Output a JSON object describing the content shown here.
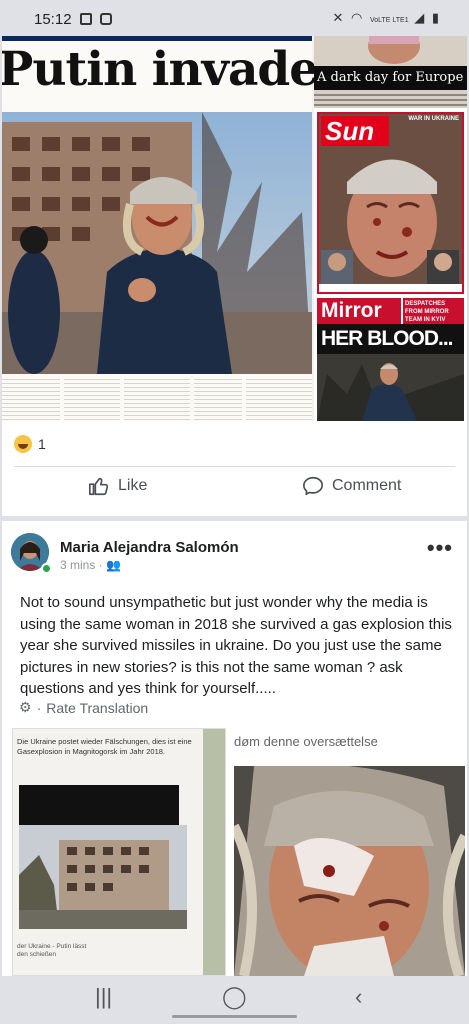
{
  "status_bar": {
    "time": "15:12",
    "network": "VoLTE LTE1",
    "icons": [
      "image-notification-icon",
      "app-notification-icon",
      "mute-icon",
      "wifi-icon",
      "signal-icon",
      "battery-icon"
    ]
  },
  "post": {
    "newspapers": {
      "guardian_headline": "Putin invade",
      "telegraph_banner": "A dark day for Europe",
      "sun_logo": "Sun",
      "sun_tag": "WAR IN UKRAINE",
      "mirror_logo": "Mirror",
      "mirror_tag": "DESPATCHES FROM MIRROR TEAM IN KYIV",
      "mirror_headline": "HER BLOOD..."
    },
    "reaction_count": "1",
    "actions": {
      "like": "Like",
      "comment": "Comment"
    }
  },
  "comment": {
    "author": "Maria Alejandra Salomón",
    "meta": "3 mins · ",
    "text": "Not to sound unsympathetic but just wonder why the media is using the same woman in 2018 she survived a gas explosion this year she survived missiles in ukraine. Do you just use the same pictures in new stories? is this not the same woman ? ask questions and yes think for yourself.....",
    "translate_label": "Rate Translation",
    "left_image_text": "Die Ukraine postet wieder Fälschungen, dies ist eine Gasexplosion in Magnitogorsk im Jahr 2018.",
    "left_image_bottom": "der Ukraine - Putin lässt den schießen",
    "right_image_caption": "døm denne oversættelse"
  },
  "colors": {
    "background": "#dfe1e6",
    "card": "#ffffff",
    "sun_red": "#c8102e",
    "facebook_text": "#1c1e21",
    "meta_grey": "#90949c",
    "online_green": "#31a24c"
  }
}
